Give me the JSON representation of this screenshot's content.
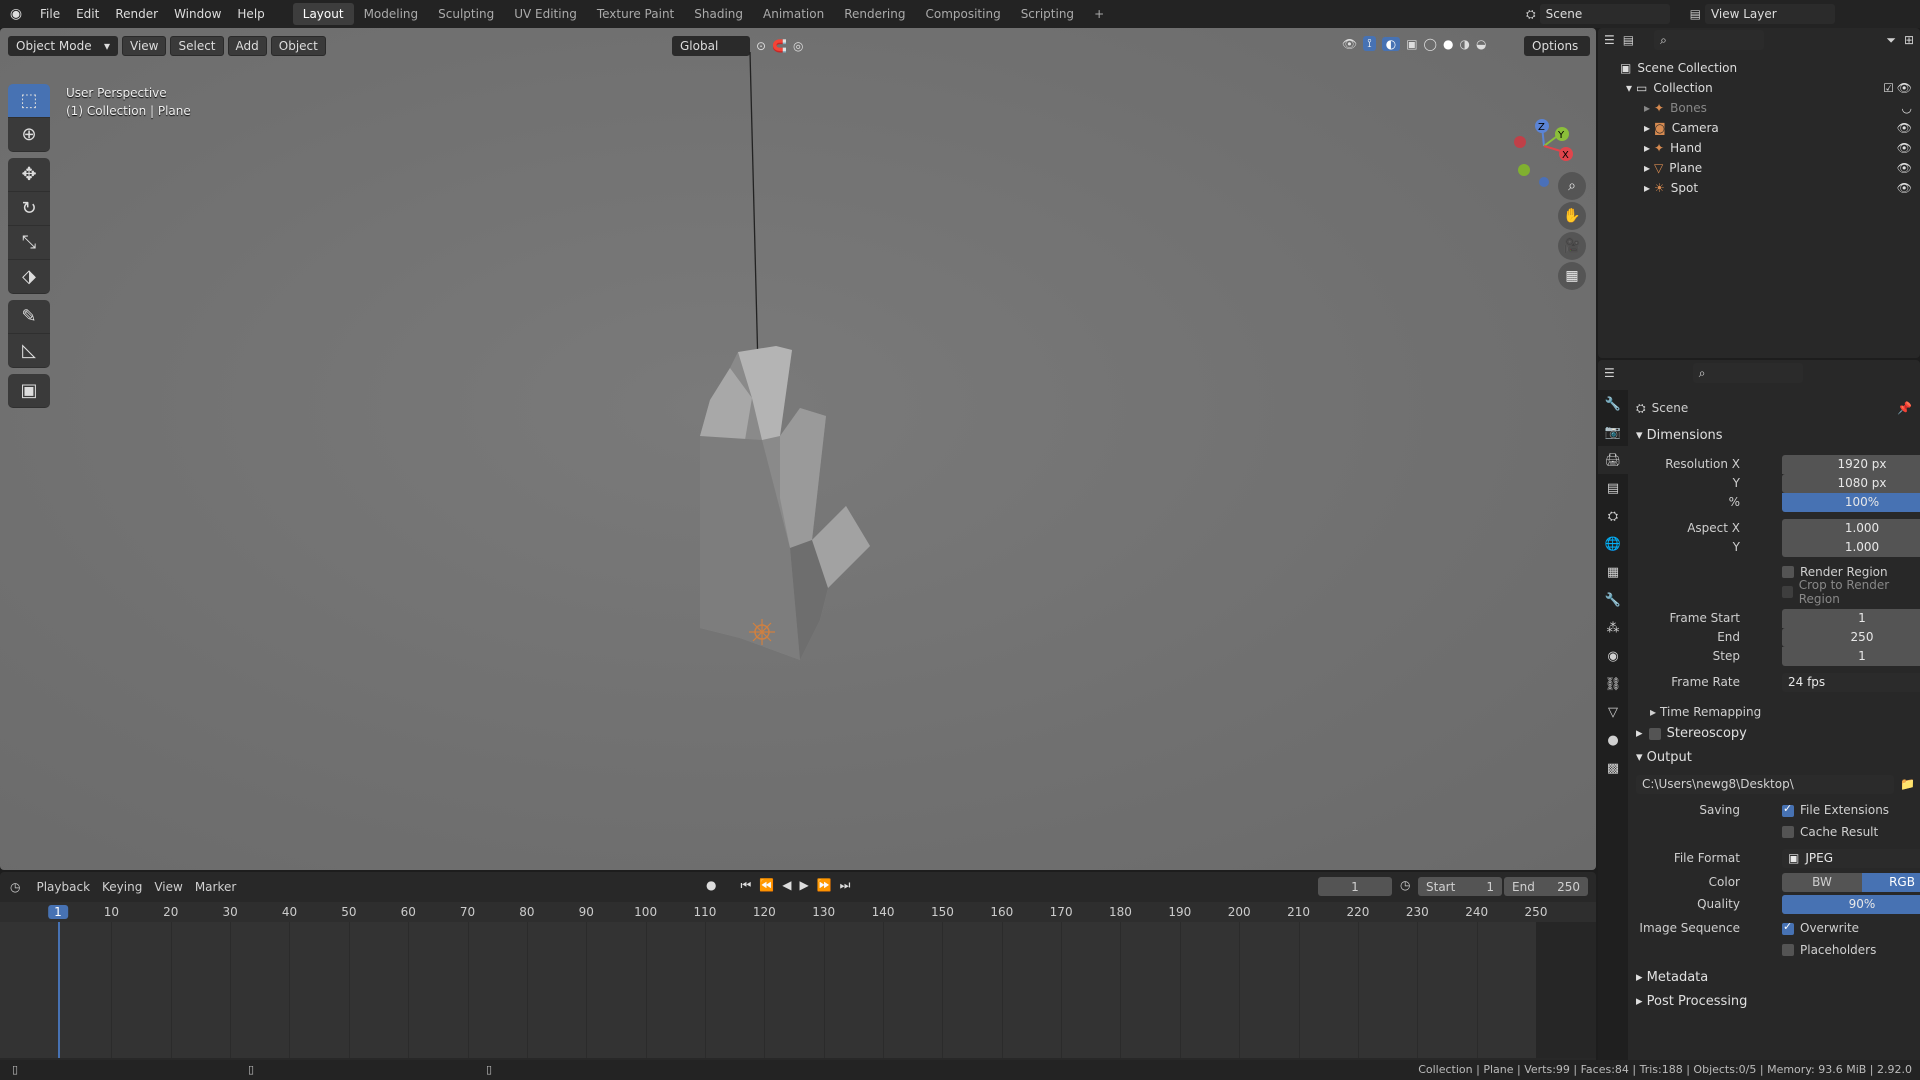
{
  "topbar": {
    "menus": [
      "File",
      "Edit",
      "Render",
      "Window",
      "Help"
    ],
    "workspaces": [
      "Layout",
      "Modeling",
      "Sculpting",
      "UV Editing",
      "Texture Paint",
      "Shading",
      "Animation",
      "Rendering",
      "Compositing",
      "Scripting"
    ],
    "active_workspace": "Layout",
    "add_tab": "+",
    "scene_name": "Scene",
    "view_layer": "View Layer"
  },
  "viewport": {
    "mode": "Object Mode",
    "menus": [
      "View",
      "Select",
      "Add",
      "Object"
    ],
    "transform_orientation": "Global",
    "options": "Options",
    "overlay_line1": "User Perspective",
    "overlay_line2": "(1) Collection | Plane",
    "gizmo": {
      "z": "Z",
      "y": "Y",
      "x": "X"
    }
  },
  "tools": [
    {
      "icon": "select-box-icon",
      "glyph": "⬚"
    },
    {
      "icon": "cursor-icon",
      "glyph": "⊕"
    },
    {
      "icon": "move-icon",
      "glyph": "✥"
    },
    {
      "icon": "rotate-icon",
      "glyph": "↻"
    },
    {
      "icon": "scale-icon",
      "glyph": "⤡"
    },
    {
      "icon": "transform-icon",
      "glyph": "⬗"
    },
    {
      "icon": "annotate-icon",
      "glyph": "✎"
    },
    {
      "icon": "measure-icon",
      "glyph": "📐"
    },
    {
      "icon": "add-cube-icon",
      "glyph": "⬛"
    }
  ],
  "outliner": {
    "root": "Scene Collection",
    "collection": "Collection",
    "items": [
      {
        "name": "Bones",
        "dim": true,
        "color": "#d68a50"
      },
      {
        "name": "Camera",
        "dim": false,
        "color": "#d68a50"
      },
      {
        "name": "Hand",
        "dim": false,
        "color": "#d68a50"
      },
      {
        "name": "Plane",
        "dim": false,
        "color": "#d68a50"
      },
      {
        "name": "Spot",
        "dim": false,
        "color": "#d68a50"
      }
    ]
  },
  "properties": {
    "context": "Scene",
    "dimensions_header": "Dimensions",
    "res_x_label": "Resolution X",
    "res_x": "1920 px",
    "res_y_label": "Y",
    "res_y": "1080 px",
    "res_pct_label": "%",
    "res_pct": "100%",
    "aspect_x_label": "Aspect X",
    "aspect_x": "1.000",
    "aspect_y_label": "Y",
    "aspect_y": "1.000",
    "render_region": "Render Region",
    "crop_region": "Crop to Render Region",
    "frame_start_label": "Frame Start",
    "frame_start": "1",
    "frame_end_label": "End",
    "frame_end": "250",
    "frame_step_label": "Step",
    "frame_step": "1",
    "frame_rate_label": "Frame Rate",
    "frame_rate": "24 fps",
    "time_remapping": "Time Remapping",
    "stereoscopy": "Stereoscopy",
    "output_header": "Output",
    "output_path": "C:\\Users\\newg8\\Desktop\\",
    "saving_label": "Saving",
    "file_extensions": "File Extensions",
    "cache_result": "Cache Result",
    "file_format_label": "File Format",
    "file_format": "JPEG",
    "color_label": "Color",
    "color_bw": "BW",
    "color_rgb": "RGB",
    "quality_label": "Quality",
    "quality": "90%",
    "quality_fraction": 0.9,
    "image_sequence_label": "Image Sequence",
    "overwrite": "Overwrite",
    "placeholders": "Placeholders",
    "metadata": "Metadata",
    "post_processing": "Post Processing"
  },
  "timeline": {
    "menus": [
      "Playback",
      "Keying",
      "View",
      "Marker"
    ],
    "current_frame": "1",
    "start_label": "Start",
    "start": "1",
    "end_label": "End",
    "end": "250",
    "ruler": [
      "1",
      "10",
      "20",
      "30",
      "40",
      "50",
      "60",
      "70",
      "80",
      "90",
      "100",
      "110",
      "120",
      "130",
      "140",
      "150",
      "160",
      "170",
      "180",
      "190",
      "200",
      "210",
      "220",
      "230",
      "240",
      "250"
    ]
  },
  "status": {
    "stats": "Collection | Plane | Verts:99 | Faces:84 | Tris:188 | Objects:0/5 | Memory: 93.6 MiB | 2.92.0"
  },
  "colors": {
    "accent": "#4772b3",
    "bg_dark": "#1d1d1d",
    "panel": "#282828",
    "viewport": "#707070"
  }
}
